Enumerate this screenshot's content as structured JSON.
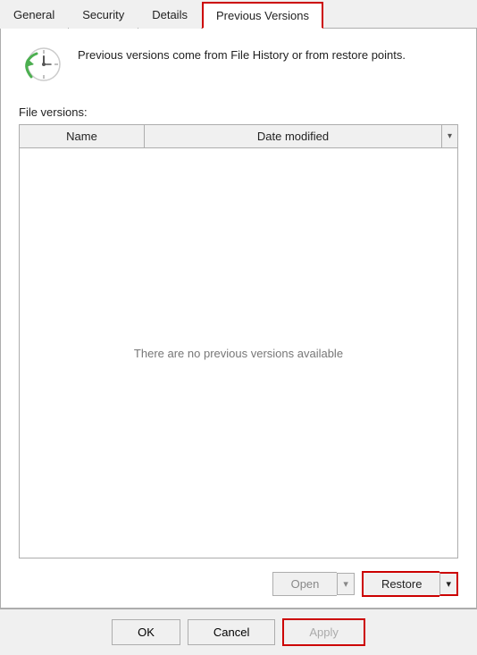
{
  "tabs": [
    {
      "id": "general",
      "label": "General",
      "active": false
    },
    {
      "id": "security",
      "label": "Security",
      "active": false
    },
    {
      "id": "details",
      "label": "Details",
      "active": false
    },
    {
      "id": "previous-versions",
      "label": "Previous Versions",
      "active": true
    }
  ],
  "info": {
    "description": "Previous versions come from File History or from restore points."
  },
  "file_versions": {
    "label": "File versions:",
    "columns": {
      "name": "Name",
      "date_modified": "Date modified"
    },
    "empty_message": "There are no previous versions available"
  },
  "buttons": {
    "open": "Open",
    "restore": "Restore",
    "ok": "OK",
    "cancel": "Cancel",
    "apply": "Apply"
  },
  "icons": {
    "clock_arrow": "↩",
    "chevron_down": "▾"
  }
}
